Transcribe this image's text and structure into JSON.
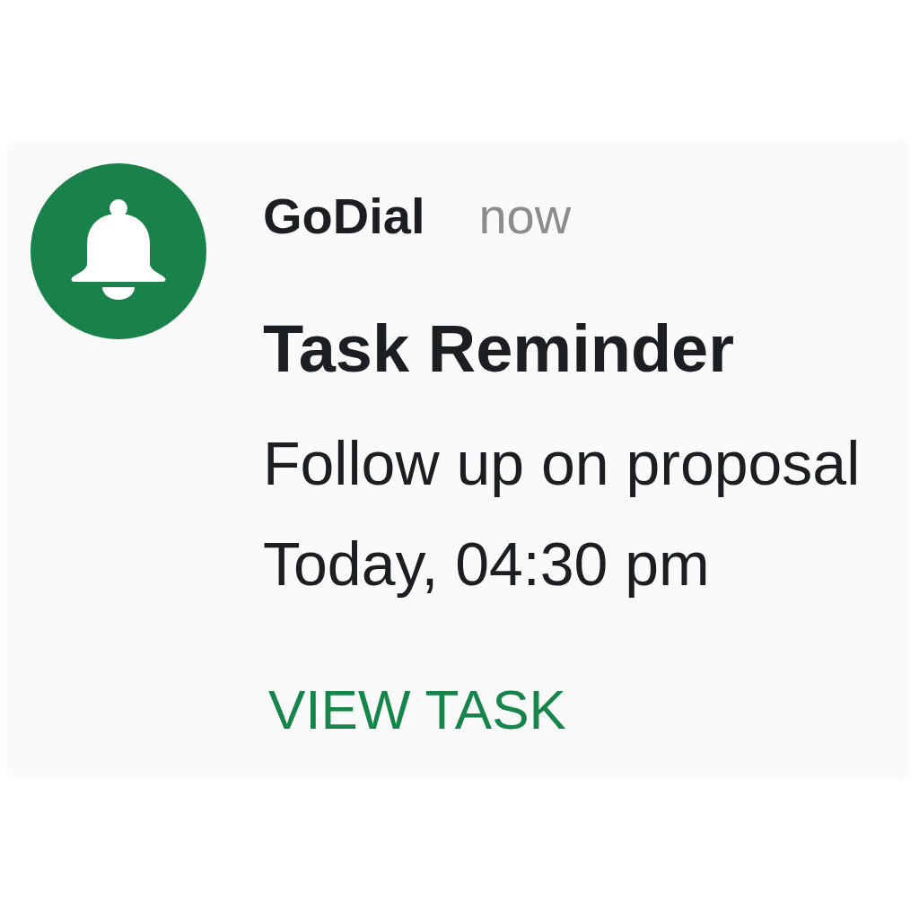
{
  "notification": {
    "app_name": "GoDial",
    "time": "now",
    "title": "Task Reminder",
    "message": "Follow up on proposal",
    "due": "Today, 04:30 pm",
    "action": "VIEW TASK"
  }
}
